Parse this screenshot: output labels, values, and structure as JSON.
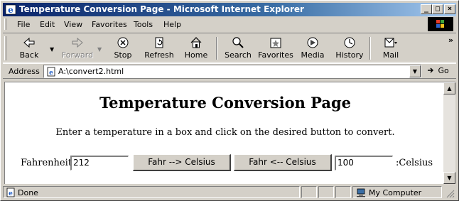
{
  "window": {
    "title": "Temperature Conversion Page - Microsoft Internet Explorer"
  },
  "menu": [
    "File",
    "Edit",
    "View",
    "Favorites",
    "Tools",
    "Help"
  ],
  "toolbar": {
    "back": "Back",
    "forward": "Forward",
    "stop": "Stop",
    "refresh": "Refresh",
    "home": "Home",
    "search": "Search",
    "favorites": "Favorites",
    "media": "Media",
    "history": "History",
    "mail": "Mail"
  },
  "address": {
    "label": "Address",
    "url": "A:\\convert2.html",
    "go": "Go"
  },
  "page": {
    "heading": "Temperature Conversion Page",
    "instructions": "Enter a temperature in a box and click on the desired button to convert.",
    "fahrenheit_label": "Fahrenheit:",
    "fahrenheit_value": "212",
    "to_celsius_button": "Fahr --> Celsius",
    "to_fahr_button": "Fahr <-- Celsius",
    "celsius_value": "100",
    "celsius_label": ":Celsius"
  },
  "status": {
    "text": "Done",
    "zone": "My Computer"
  }
}
